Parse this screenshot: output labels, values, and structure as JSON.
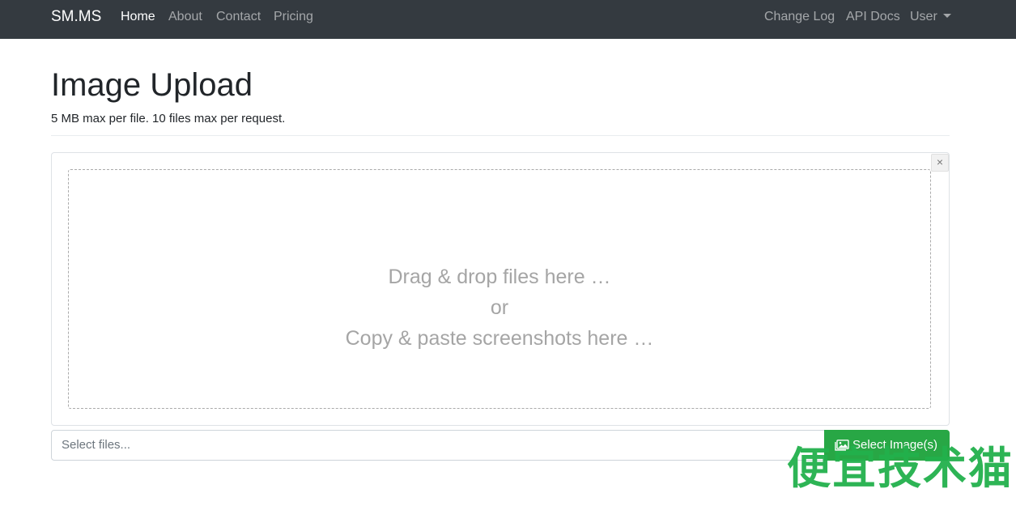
{
  "navbar": {
    "brand": "SM.MS",
    "left_links": [
      {
        "label": "Home",
        "active": true
      },
      {
        "label": "About"
      },
      {
        "label": "Contact"
      },
      {
        "label": "Pricing"
      }
    ],
    "right_links": [
      {
        "label": "Change Log"
      },
      {
        "label": "API Docs"
      },
      {
        "label": "User",
        "dropdown": true
      }
    ]
  },
  "main": {
    "title": "Image Upload",
    "subtitle": "5 MB max per file. 10 files max per request."
  },
  "dropzone": {
    "line1": "Drag & drop files here …",
    "line2": "or",
    "line3": "Copy & paste screenshots here …",
    "close_glyph": "×"
  },
  "file_select": {
    "placeholder": "Select files...",
    "button_label": "Select Image(s)",
    "button_icon": "images-icon"
  },
  "watermark": {
    "text": "便宜技术猫"
  },
  "colors": {
    "navbar_bg": "#343a40",
    "button_green": "#28a745",
    "watermark_green": "#22b14c"
  }
}
